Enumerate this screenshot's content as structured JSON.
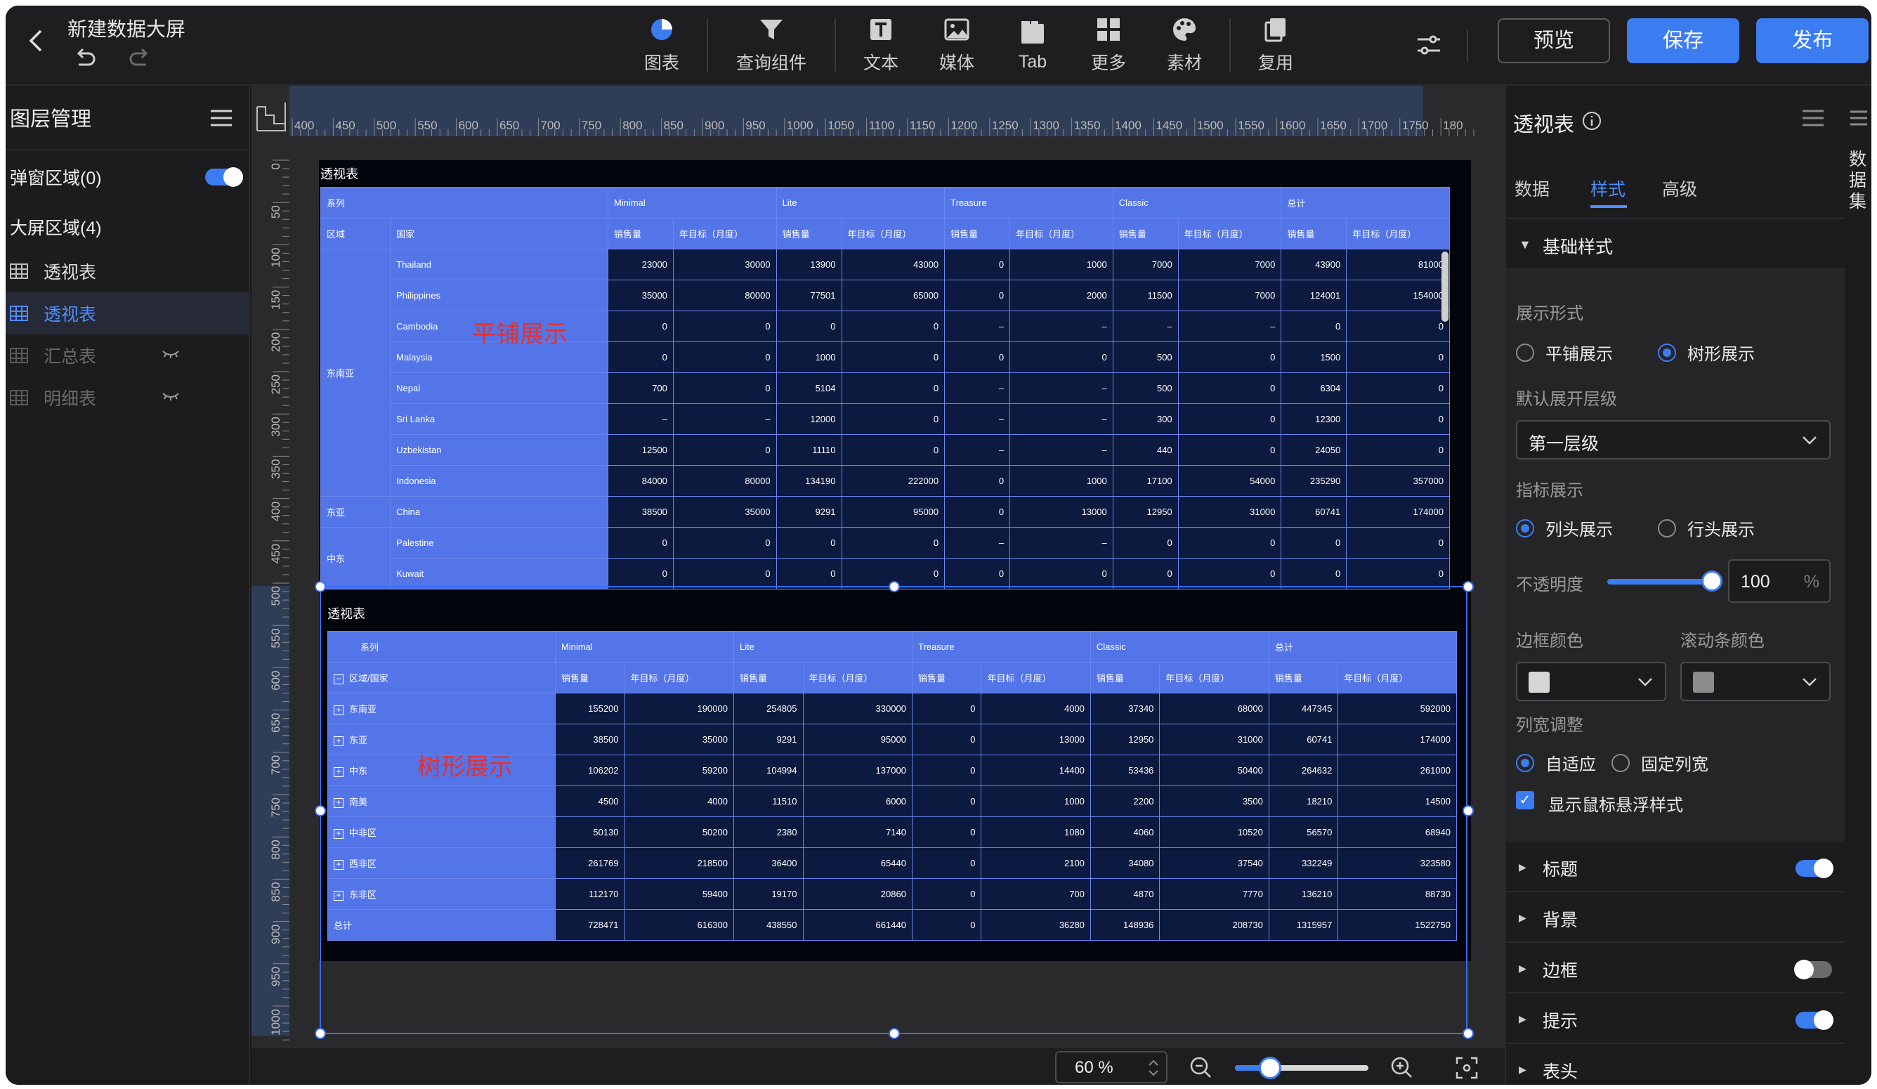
{
  "header": {
    "title": "新建数据大屏",
    "toolbar": [
      {
        "label": "图表",
        "icon": "pie-chart-icon"
      },
      {
        "label": "查询组件",
        "icon": "funnel-icon"
      },
      {
        "label": "文本",
        "icon": "text-icon"
      },
      {
        "label": "媒体",
        "icon": "image-icon"
      },
      {
        "label": "Tab",
        "icon": "tab-icon"
      },
      {
        "label": "更多",
        "icon": "grid-icon"
      },
      {
        "label": "素材",
        "icon": "palette-icon"
      },
      {
        "label": "复用",
        "icon": "copy-icon"
      }
    ],
    "preview_label": "预览",
    "save_label": "保存",
    "publish_label": "发布"
  },
  "left_panel": {
    "title": "图层管理",
    "popup_area": "弹窗区域(0)",
    "screen_area": "大屏区域(4)",
    "layers": [
      {
        "label": "透视表",
        "state": "normal"
      },
      {
        "label": "透视表",
        "state": "active"
      },
      {
        "label": "汇总表",
        "state": "hidden"
      },
      {
        "label": "明细表",
        "state": "hidden"
      }
    ]
  },
  "canvas": {
    "hruler_labels": [
      "400",
      "450",
      "500",
      "550",
      "600",
      "650",
      "700",
      "750",
      "800",
      "850",
      "900",
      "950",
      "1000",
      "1050",
      "1100",
      "1150",
      "1200",
      "1250",
      "1300",
      "1350",
      "1400",
      "1450",
      "1500",
      "1550",
      "1600",
      "1650",
      "1700",
      "1750",
      "180"
    ],
    "vruler_labels": [
      "0",
      "50",
      "100",
      "150",
      "200",
      "250",
      "300",
      "350",
      "400",
      "450",
      "500",
      "550",
      "600",
      "650",
      "700",
      "750",
      "800",
      "850",
      "900",
      "950",
      "1000"
    ],
    "zoom": "60 %"
  },
  "pivot_top": {
    "title": "透视表",
    "annotation": "平铺展示",
    "header1": [
      "系列",
      "Minimal",
      "Lite",
      "Treasure",
      "Classic",
      "总计"
    ],
    "header2": [
      "区域",
      "国家",
      "销售量",
      "年目标（月度）",
      "销售量",
      "年目标（月度）",
      "销售量",
      "年目标（月度）",
      "销售量",
      "年目标（月度）",
      "销售量",
      "年目标（月度）"
    ],
    "groups": [
      {
        "region": "东南亚",
        "rows": [
          {
            "country": "Thailand",
            "values": [
              "23000",
              "30000",
              "13900",
              "43000",
              "0",
              "1000",
              "7000",
              "7000",
              "43900",
              "81000"
            ]
          },
          {
            "country": "Philippines",
            "values": [
              "35000",
              "80000",
              "77501",
              "65000",
              "0",
              "2000",
              "11500",
              "7000",
              "124001",
              "154000"
            ]
          },
          {
            "country": "Cambodia",
            "values": [
              "0",
              "0",
              "0",
              "0",
              "–",
              "–",
              "–",
              "–",
              "0",
              "0"
            ]
          },
          {
            "country": "Malaysia",
            "values": [
              "0",
              "0",
              "1000",
              "0",
              "0",
              "0",
              "500",
              "0",
              "1500",
              "0"
            ]
          },
          {
            "country": "Nepal",
            "values": [
              "700",
              "0",
              "5104",
              "0",
              "–",
              "–",
              "500",
              "0",
              "6304",
              "0"
            ]
          },
          {
            "country": "Sri Lanka",
            "values": [
              "–",
              "–",
              "12000",
              "0",
              "–",
              "–",
              "300",
              "0",
              "12300",
              "0"
            ]
          },
          {
            "country": "Uzbekistan",
            "values": [
              "12500",
              "0",
              "11110",
              "0",
              "–",
              "–",
              "440",
              "0",
              "24050",
              "0"
            ]
          },
          {
            "country": "Indonesia",
            "values": [
              "84000",
              "80000",
              "134190",
              "222000",
              "0",
              "1000",
              "17100",
              "54000",
              "235290",
              "357000"
            ]
          }
        ]
      },
      {
        "region": "东亚",
        "rows": [
          {
            "country": "China",
            "values": [
              "38500",
              "35000",
              "9291",
              "95000",
              "0",
              "13000",
              "12950",
              "31000",
              "60741",
              "174000"
            ]
          }
        ]
      },
      {
        "region": "中东",
        "rows": [
          {
            "country": "Palestine",
            "values": [
              "0",
              "0",
              "0",
              "0",
              "–",
              "–",
              "0",
              "0",
              "0",
              "0"
            ]
          },
          {
            "country": "Kuwait",
            "values": [
              "0",
              "0",
              "0",
              "0",
              "0",
              "0",
              "0",
              "0",
              "0",
              "0"
            ]
          }
        ]
      }
    ]
  },
  "pivot_bottom": {
    "title": "透视表",
    "annotation": "树形展示",
    "header1": [
      "系列",
      "Minimal",
      "Lite",
      "Treasure",
      "Classic",
      "总计"
    ],
    "header2_first": "区域/国家",
    "header2": [
      "销售量",
      "年目标（月度）",
      "销售量",
      "年目标（月度）",
      "销售量",
      "年目标（月度）",
      "销售量",
      "年目标（月度）",
      "销售量",
      "年目标（月度）"
    ],
    "rows": [
      {
        "label": "东南亚",
        "values": [
          "155200",
          "190000",
          "254805",
          "330000",
          "0",
          "4000",
          "37340",
          "68000",
          "447345",
          "592000"
        ]
      },
      {
        "label": "东亚",
        "values": [
          "38500",
          "35000",
          "9291",
          "95000",
          "0",
          "13000",
          "12950",
          "31000",
          "60741",
          "174000"
        ]
      },
      {
        "label": "中东",
        "values": [
          "106202",
          "59200",
          "104994",
          "137000",
          "0",
          "14400",
          "53436",
          "50400",
          "264632",
          "261000"
        ]
      },
      {
        "label": "南美",
        "values": [
          "4500",
          "4000",
          "11510",
          "6000",
          "0",
          "1000",
          "2200",
          "3500",
          "18210",
          "14500"
        ]
      },
      {
        "label": "中非区",
        "values": [
          "50130",
          "50200",
          "2380",
          "7140",
          "0",
          "1080",
          "4060",
          "10520",
          "56570",
          "68940"
        ]
      },
      {
        "label": "西非区",
        "values": [
          "261769",
          "218500",
          "36400",
          "65440",
          "0",
          "2100",
          "34080",
          "37540",
          "332249",
          "323580"
        ]
      },
      {
        "label": "东非区",
        "values": [
          "112170",
          "59400",
          "19170",
          "20860",
          "0",
          "700",
          "4870",
          "7770",
          "136210",
          "88730"
        ]
      }
    ],
    "total": {
      "label": "总计",
      "values": [
        "728471",
        "616300",
        "438550",
        "661440",
        "0",
        "36280",
        "148936",
        "208730",
        "1315957",
        "1522750"
      ]
    }
  },
  "right_panel": {
    "title": "透视表",
    "tabs": [
      "数据",
      "样式",
      "高级"
    ],
    "active_tab": "样式",
    "basic_section": "基础样式",
    "display_mode_label": "展示形式",
    "display_modes": [
      "平铺展示",
      "树形展示"
    ],
    "display_mode_selected": "树形展示",
    "expand_level_label": "默认展开层级",
    "expand_level_value": "第一层级",
    "metric_display_label": "指标展示",
    "metric_modes": [
      "列头展示",
      "行头展示"
    ],
    "metric_mode_selected": "列头展示",
    "opacity_label": "不透明度",
    "opacity_value": "100",
    "opacity_unit": "%",
    "opacity_level": 1.0,
    "border_color_label": "边框颜色",
    "scroll_color_label": "滚动条颜色",
    "border_color": "#d6d6d6",
    "scroll_color": "#8c8c8c",
    "col_width_label": "列宽调整",
    "col_width_modes": [
      "自适应",
      "固定列宽"
    ],
    "col_width_selected": "自适应",
    "hover_checkbox_label": "显示鼠标悬浮样式",
    "sections": [
      {
        "name": "标题",
        "toggle": true
      },
      {
        "name": "背景",
        "toggle": null
      },
      {
        "name": "边框",
        "toggle": false
      },
      {
        "name": "提示",
        "toggle": true
      },
      {
        "name": "表头",
        "toggle": null
      }
    ]
  },
  "dataset_tab": "数据集",
  "colors": {
    "accent": "#3b7cf0",
    "table_header": "#5475e8",
    "table_cell": "#0b1a3e",
    "annotation": "#e53030"
  }
}
